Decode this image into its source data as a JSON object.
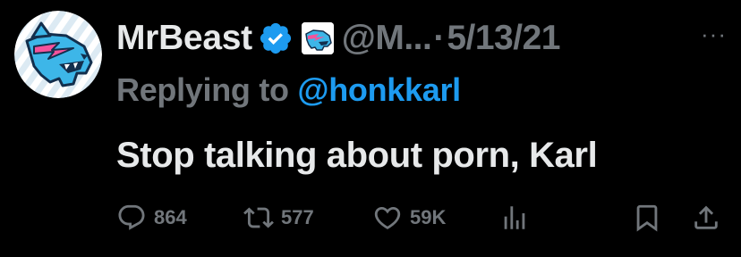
{
  "tweet": {
    "author_name": "MrBeast",
    "handle": "@M...",
    "separator": "·",
    "date": "5/13/21",
    "more_label": "···",
    "replying_prefix": "Replying to",
    "replying_to": "@honkkarl",
    "text": "Stop talking about porn, Karl"
  },
  "actions": {
    "replies": "864",
    "retweets": "577",
    "likes": "59K"
  },
  "icons": {
    "avatar": "mrbeast-panther-logo",
    "verified": "verified-badge-icon",
    "org_badge": "affiliate-badge-icon",
    "reply": "reply-icon",
    "retweet": "retweet-icon",
    "like": "heart-icon",
    "views": "analytics-icon",
    "bookmark": "bookmark-icon",
    "share": "share-icon"
  },
  "colors": {
    "background": "#000000",
    "primary_text": "#e7e9ea",
    "secondary_text": "#71767b",
    "accent": "#1d9bf0"
  }
}
